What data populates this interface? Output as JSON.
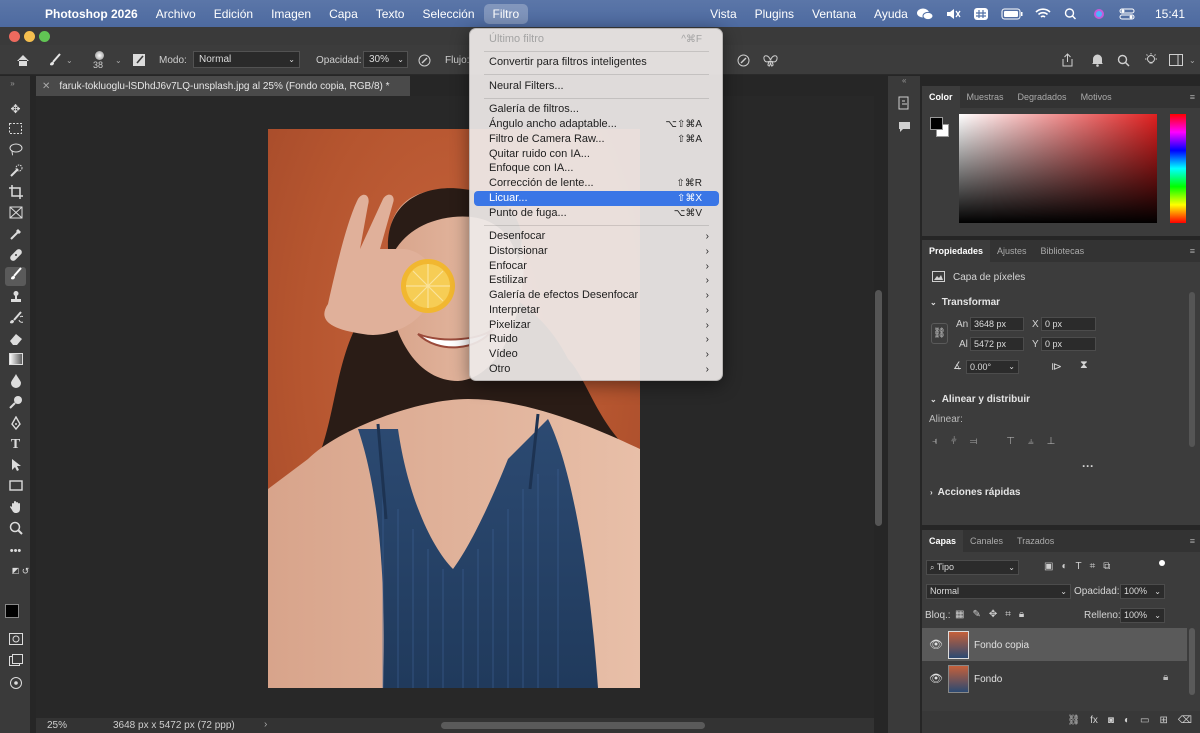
{
  "menubar": {
    "app_name": "Photoshop 2026",
    "items": [
      "Archivo",
      "Edición",
      "Imagen",
      "Capa",
      "Texto",
      "Selección",
      "Filtro"
    ],
    "right_items": [
      "Vista",
      "Plugins",
      "Ventana",
      "Ayuda"
    ],
    "clock": "15:41"
  },
  "options_bar": {
    "brush_size": "38",
    "mode_label": "Modo:",
    "mode_value": "Normal",
    "opacity_label": "Opacidad:",
    "opacity_value": "30%",
    "flow_label": "Flujo:"
  },
  "document": {
    "tab_title": "faruk-tokluoglu-lSDhdJ6v7LQ-unsplash.jpg al 25% (Fondo copia, RGB/8) *",
    "zoom": "25%",
    "dimensions": "3648 px x 5472 px (72 ppp)"
  },
  "filter_menu": {
    "last_filter": "Último filtro",
    "last_filter_shortcut": "^⌘F",
    "convert_smart": "Convertir para filtros inteligentes",
    "neural": "Neural Filters...",
    "items_group": [
      {
        "label": "Galería de filtros...",
        "shortcut": ""
      },
      {
        "label": "Ángulo ancho adaptable...",
        "shortcut": "⌥⇧⌘A"
      },
      {
        "label": "Filtro de Camera Raw...",
        "shortcut": "⇧⌘A"
      },
      {
        "label": "Quitar ruido con IA...",
        "shortcut": ""
      },
      {
        "label": "Enfoque con IA...",
        "shortcut": ""
      },
      {
        "label": "Corrección de lente...",
        "shortcut": "⇧⌘R"
      },
      {
        "label": "Licuar...",
        "shortcut": "⇧⌘X"
      },
      {
        "label": "Punto de fuga...",
        "shortcut": "⌥⌘V"
      }
    ],
    "submenus": [
      "Desenfocar",
      "Distorsionar",
      "Enfocar",
      "Estilizar",
      "Galería de efectos Desenfocar",
      "Interpretar",
      "Pixelizar",
      "Ruido",
      "Vídeo",
      "Otro"
    ]
  },
  "color_panel": {
    "tabs": [
      "Color",
      "Muestras",
      "Degradados",
      "Motivos"
    ]
  },
  "properties_panel": {
    "tabs": [
      "Propiedades",
      "Ajustes",
      "Bibliotecas"
    ],
    "layer_type": "Capa de píxeles",
    "transform_title": "Transformar",
    "width_label": "An",
    "width_value": "3648 px",
    "height_label": "Al",
    "height_value": "5472 px",
    "x_label": "X",
    "x_value": "0 px",
    "y_label": "Y",
    "y_value": "0 px",
    "angle_value": "0.00°",
    "align_title": "Alinear y distribuir",
    "align_label": "Alinear:",
    "quick_actions_title": "Acciones rápidas"
  },
  "layers_panel": {
    "tabs": [
      "Capas",
      "Canales",
      "Trazados"
    ],
    "filter_kind": "Tipo",
    "blend_mode": "Normal",
    "opacity_label": "Opacidad:",
    "opacity_value": "100%",
    "lock_label": "Bloq.:",
    "fill_label": "Relleno:",
    "fill_value": "100%",
    "layers": [
      {
        "name": "Fondo copia",
        "selected": true
      },
      {
        "name": "Fondo",
        "selected": false
      }
    ]
  },
  "colors": {
    "menu_highlight": "#3a76e6",
    "menubar": "#5271a6",
    "photo_background": "#b5552f"
  }
}
